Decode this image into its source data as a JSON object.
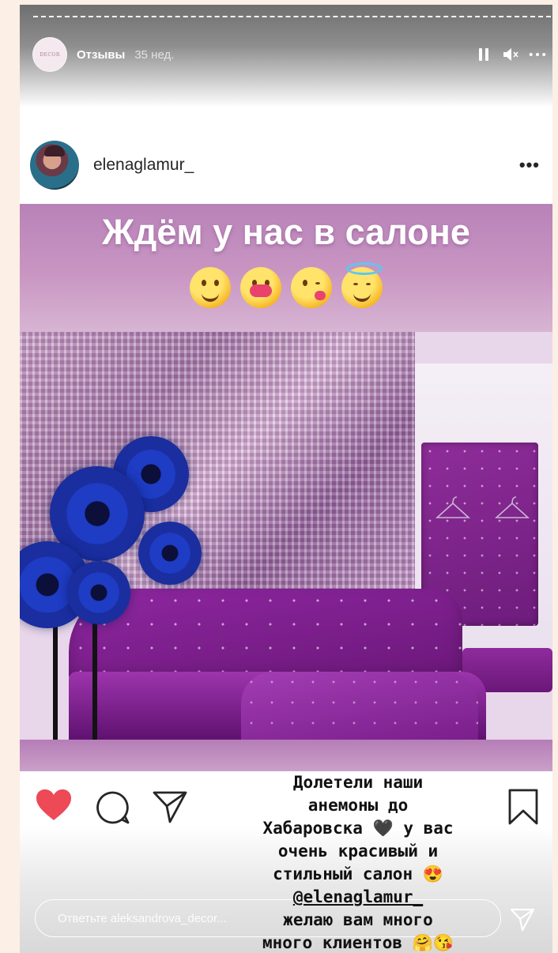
{
  "story": {
    "account_label": "Отзывы",
    "time_ago": "35 нед.",
    "avatar_text": "DECOR",
    "progress": 0.88,
    "controls": {
      "pause_icon": "pause-icon",
      "mute_icon": "mute-icon",
      "more_icon": "more-icon"
    }
  },
  "post": {
    "username": "elenaglamur_",
    "more_label": "•••"
  },
  "banner": {
    "title": "Ждём у нас в салоне",
    "emojis": [
      "hugging-face",
      "heart-with-ribbon",
      "face-blowing-kiss",
      "smiling-face-with-halo"
    ]
  },
  "actions": {
    "like_icon": "heart-icon",
    "comment_icon": "comment-icon",
    "share_icon": "share-icon",
    "save_icon": "bookmark-icon",
    "like_color": "#ed4956"
  },
  "caption": {
    "line1": "Долетели наши",
    "line2": "анемоны до",
    "line3": "Хабаровска 🖤 у вас",
    "line4": "очень красивый и",
    "line5": "стильный салон 😍",
    "mention": "@elenaglamur_",
    "line7": "желаю вам много",
    "line8": "много клиентов 🤗😘"
  },
  "reply": {
    "placeholder": "Ответьте aleksandrova_decor..."
  },
  "colors": {
    "page_bg": "#fcefe5",
    "banner_purple": "#c996c3",
    "sofa_purple": "#8e27a0"
  }
}
